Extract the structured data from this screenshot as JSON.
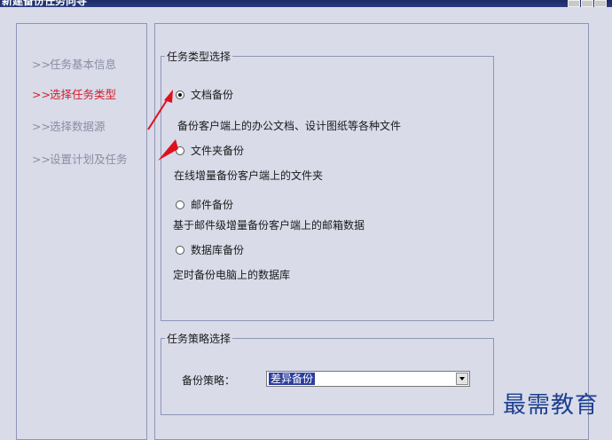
{
  "window": {
    "title": "新建备份任务向导"
  },
  "steps": [
    {
      "label": "任务基本信息",
      "active": false
    },
    {
      "label": "选择任务类型",
      "active": true
    },
    {
      "label": "选择数据源",
      "active": false
    },
    {
      "label": "设置计划及任务",
      "active": false
    }
  ],
  "step_marker": ">>",
  "task_type": {
    "legend": "任务类型选择",
    "options": [
      {
        "label": "文档备份",
        "description": "备份客户端上的办公文档、设计图纸等各种文件",
        "selected": true
      },
      {
        "label": "文件夹备份",
        "description": "在线增量备份客户端上的文件夹",
        "selected": false
      },
      {
        "label": "邮件备份",
        "description": "基于邮件级增量备份客户端上的邮箱数据",
        "selected": false
      },
      {
        "label": "数据库备份",
        "description": "定时备份电脑上的数据库",
        "selected": false
      }
    ]
  },
  "strategy": {
    "legend": "任务策略选择",
    "label": "备份策略：",
    "selected_value": "差异备份"
  },
  "colors": {
    "accent_arrow": "#e0101a",
    "active_step": "#d21f2a",
    "watermark": "#1c3f8f"
  },
  "watermark": "最需教育"
}
